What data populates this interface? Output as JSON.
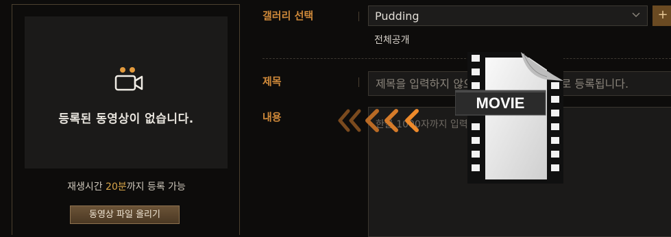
{
  "left_panel": {
    "empty_message": "등록된 동영상이 없습니다.",
    "limit_prefix": "재생시간 ",
    "limit_highlight": "20분",
    "limit_suffix": "까지 등록 가능",
    "upload_button": "동영상 파일 올리기",
    "icon": "video-camera-icon"
  },
  "form": {
    "gallery_label": "갤러리 선택",
    "gallery_value": "Pudding",
    "add_button": "+",
    "visibility": "전체공개",
    "title_label": "제목",
    "title_placeholder": "제목을 입력하지 않으면 파일명이 제목으로 등록됩니다.",
    "content_label": "내용",
    "content_placeholder": "한글 1000자까지 입력할 수 있습니다."
  },
  "overlay": {
    "badge": "MOVIE",
    "arrow_icon": "double-chevron-left-icon",
    "file_icon": "movie-file-icon"
  },
  "colors": {
    "accent": "#d08a3a",
    "highlight": "#d9a64a",
    "background": "#0d0c0b"
  }
}
